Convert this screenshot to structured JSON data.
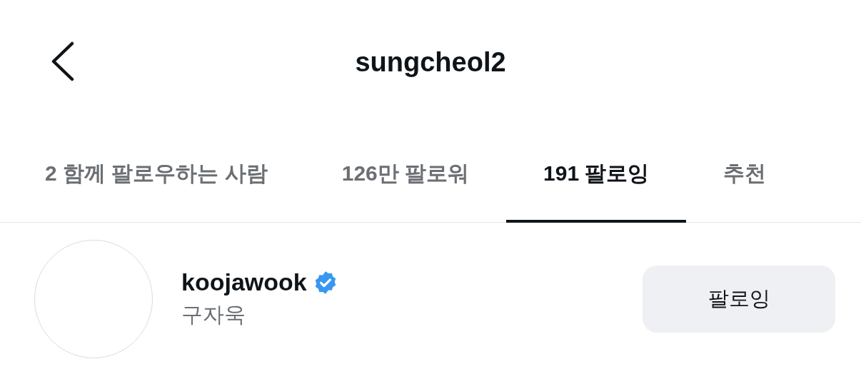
{
  "header": {
    "title": "sungcheol2"
  },
  "tabs": [
    {
      "label": "2 함께 팔로우하는 사람",
      "selected": false
    },
    {
      "label": "126만 팔로워",
      "selected": false
    },
    {
      "label": "191 팔로잉",
      "selected": true
    },
    {
      "label": "추천",
      "selected": false
    }
  ],
  "users": [
    {
      "name": "koojawook",
      "verified": true,
      "display_name": "구자욱",
      "button": "팔로잉"
    }
  ]
}
